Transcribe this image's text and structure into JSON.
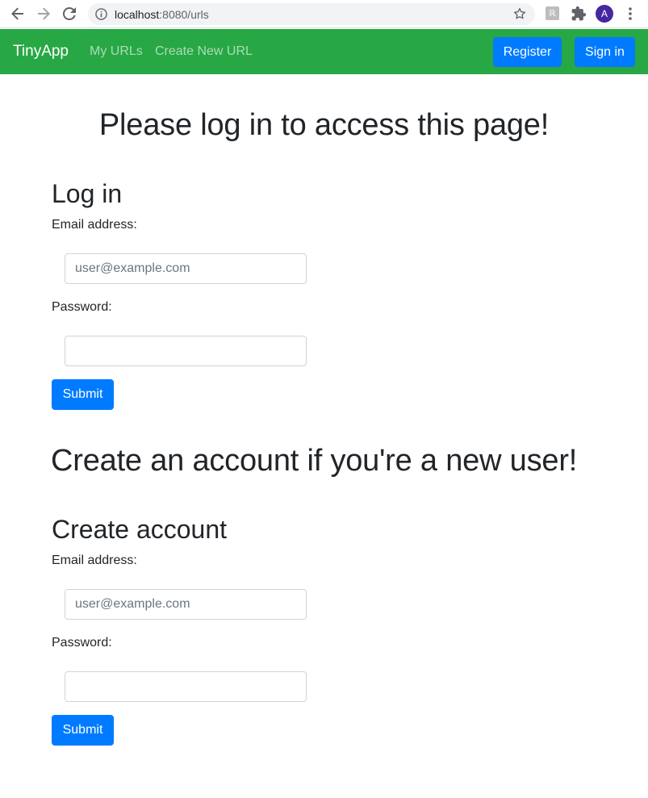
{
  "browser": {
    "url_host": "localhost",
    "url_rest": ":8080/urls",
    "avatar_letter": "A",
    "icons": [
      "back-arrow-icon",
      "forward-arrow-icon",
      "reload-icon",
      "info-icon",
      "star-icon",
      "extension-icon",
      "puzzle-icon",
      "more-vert-icon"
    ]
  },
  "navbar": {
    "brand": "TinyApp",
    "links": [
      "My URLs",
      "Create New URL"
    ],
    "register_label": "Register",
    "signin_label": "Sign in",
    "bg_color": "#28a745",
    "button_color": "#007bff"
  },
  "main": {
    "login_heading": "Please log in to access this page!",
    "login_form": {
      "title": "Log in",
      "email_label": "Email address:",
      "email_placeholder": "user@example.com",
      "password_label": "Password:",
      "submit_label": "Submit"
    },
    "register_heading": "Create an account if you're a new user!",
    "register_form": {
      "title": "Create account",
      "email_label": "Email address:",
      "email_placeholder": "user@example.com",
      "password_label": "Password:",
      "submit_label": "Submit"
    }
  }
}
